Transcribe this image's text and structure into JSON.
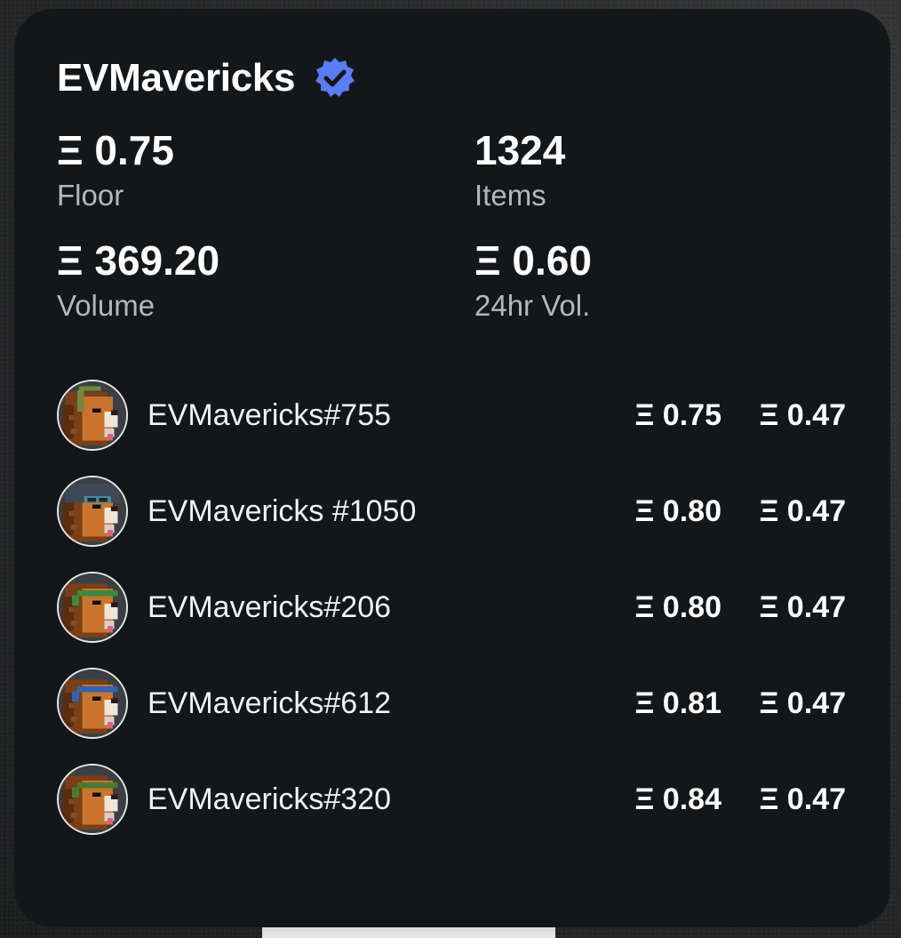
{
  "collection": {
    "name": "EVMavericks",
    "verified_icon": "verified-badge-icon",
    "accent": "#5b7cf2"
  },
  "stats": {
    "floor": {
      "value": "Ξ 0.75",
      "label": "Floor"
    },
    "items": {
      "value": "1324",
      "label": "Items"
    },
    "volume": {
      "value": "Ξ 369.20",
      "label": "Volume"
    },
    "vol24": {
      "value": "Ξ 0.60",
      "label": "24hr Vol."
    }
  },
  "listings": [
    {
      "name": "EVMavericks#755",
      "price": "Ξ 0.75",
      "offer": "Ξ 0.47",
      "accessory": "headphones",
      "accessory_color": "#6f8a3c"
    },
    {
      "name": "EVMavericks #1050",
      "price": "Ξ 0.80",
      "offer": "Ξ 0.47",
      "accessory": "aviator",
      "accessory_color": "#4d8a8f"
    },
    {
      "name": "EVMavericks#206",
      "price": "Ξ 0.80",
      "offer": "Ξ 0.47",
      "accessory": "headband",
      "accessory_color": "#3a8a3f"
    },
    {
      "name": "EVMavericks#612",
      "price": "Ξ 0.81",
      "offer": "Ξ 0.47",
      "accessory": "headband",
      "accessory_color": "#2f63b3"
    },
    {
      "name": "EVMavericks#320",
      "price": "Ξ 0.84",
      "offer": "Ξ 0.47",
      "accessory": "headband",
      "accessory_color": "#4a7a2e"
    }
  ],
  "colors": {
    "card_bg": "#14171a",
    "label": "#b4b7bb",
    "lion_fur": "#c8742e",
    "lion_mane": "#7a3f16"
  }
}
